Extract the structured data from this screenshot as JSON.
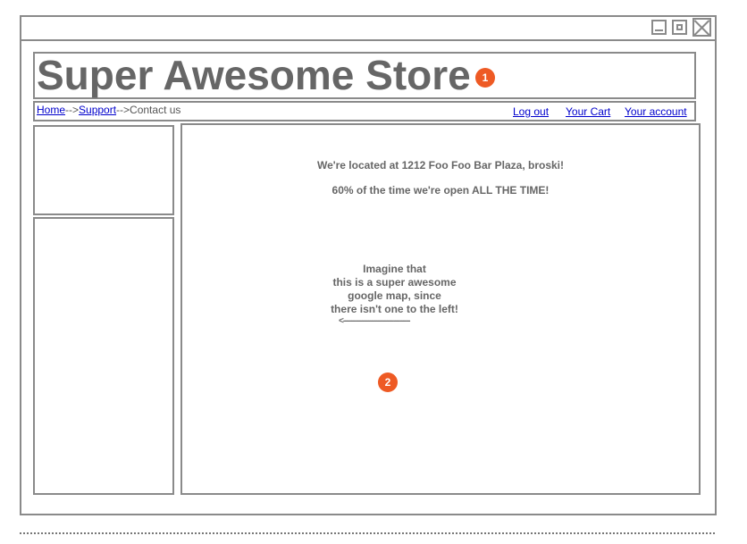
{
  "window": {
    "controls": {
      "minimize": "minimize-icon",
      "maximize": "maximize-icon",
      "close": "close-icon"
    }
  },
  "header": {
    "title": "Super Awesome Store"
  },
  "markers": {
    "first": "1",
    "second": "2"
  },
  "breadcrumb": {
    "home": "Home",
    "sep1": "-->",
    "support": "Support",
    "sep2": "-->",
    "current": "Contact us"
  },
  "account_links": {
    "logout": "Log out",
    "cart": "Your Cart",
    "account": "Your account"
  },
  "main": {
    "location": "We're located at 1212 Foo Foo Bar Plaza, broski!",
    "hours": "60% of the time we're open ALL THE TIME!",
    "map_note_lines": [
      "Imagine that",
      "this is a super awesome",
      "google map, since",
      "there isn't one to the left!"
    ],
    "arrow": "<--------------------------------"
  },
  "colors": {
    "border": "#8a8a8a",
    "text": "#666666",
    "link": "#0000cc",
    "marker": "#ee5a24"
  }
}
